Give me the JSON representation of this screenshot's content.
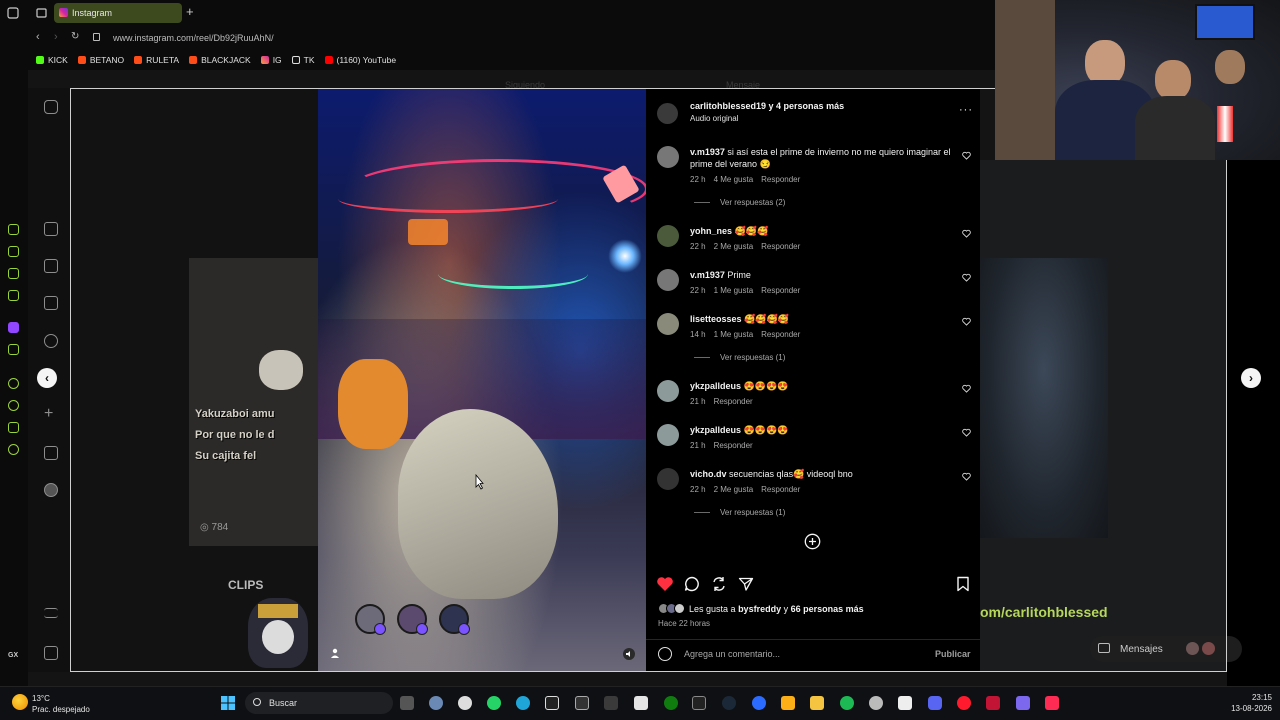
{
  "browser": {
    "tab_title": "Instagram",
    "url": "www.instagram.com/reel/Db92jRuuAhN/",
    "bookmarks": [
      {
        "label": "KICK",
        "color": "#53fc18"
      },
      {
        "label": "BETANO",
        "color": "#ff4d1a"
      },
      {
        "label": "RULETA",
        "color": "#ff4d1a"
      },
      {
        "label": "BLACKJACK",
        "color": "#ff4d1a"
      },
      {
        "label": "IG",
        "color": "#d6249f"
      },
      {
        "label": "TK",
        "color": "#eeeeee"
      },
      {
        "label": "(1160) YouTube",
        "color": "#ff0000"
      }
    ]
  },
  "background": {
    "left_overlay_lines": [
      "Yakuzaboi amu",
      "Por que no le d",
      "Su cajita fel"
    ],
    "left_views": "784",
    "left_clips": "CLIPS",
    "right_url_text": "om/carlitohblessed",
    "messages_label": "Mensajes",
    "faded_tab_following": "Siguiendo",
    "faded_tab_messages": "Mensaje"
  },
  "post": {
    "author_line": "carlitohblessed19 y 4 personas más",
    "audio": "Audio original",
    "comments": [
      {
        "user": "v.m1937",
        "text": "si así esta el prime de invierno no me quiero imaginar el prime del verano 😏",
        "time": "22 h",
        "likes": "4 Me gusta",
        "reply": "Responder",
        "replies": "Ver respuestas (2)"
      },
      {
        "user": "yohn_nes",
        "text": "🥰🥰🥰",
        "time": "22 h",
        "likes": "2 Me gusta",
        "reply": "Responder",
        "replies": ""
      },
      {
        "user": "v.m1937",
        "text": "Prime",
        "time": "22 h",
        "likes": "1 Me gusta",
        "reply": "Responder",
        "replies": ""
      },
      {
        "user": "lisetteosses",
        "text": "🥰🥰🥰🥰",
        "time": "14 h",
        "likes": "1 Me gusta",
        "reply": "Responder",
        "replies": "Ver respuestas (1)"
      },
      {
        "user": "ykzpalldeus",
        "text": "😍😍😍😍",
        "time": "21 h",
        "likes": "",
        "reply": "Responder",
        "replies": ""
      },
      {
        "user": "ykzpalldeus",
        "text": "😍😍😍😍",
        "time": "21 h",
        "likes": "",
        "reply": "Responder",
        "replies": ""
      },
      {
        "user": "vicho.dv",
        "text": "secuencias qlas🥰 videoql bno",
        "time": "22 h",
        "likes": "2 Me gusta",
        "reply": "Responder",
        "replies": "Ver respuestas (1)"
      }
    ],
    "likes_text_prefix": "Les gusta a",
    "likes_user": "bysfreddy",
    "likes_text_mid": "y",
    "likes_count": "66 personas más",
    "time_ago": "Hace 22 horas",
    "comment_placeholder": "Agrega un comentario...",
    "publish_label": "Publicar",
    "liked": true,
    "accent": "#ff3040"
  },
  "taskbar": {
    "temp": "13°C",
    "weather": "Prac. despejado",
    "search": "Buscar",
    "time": "23:15",
    "date": "13-08-2026"
  }
}
